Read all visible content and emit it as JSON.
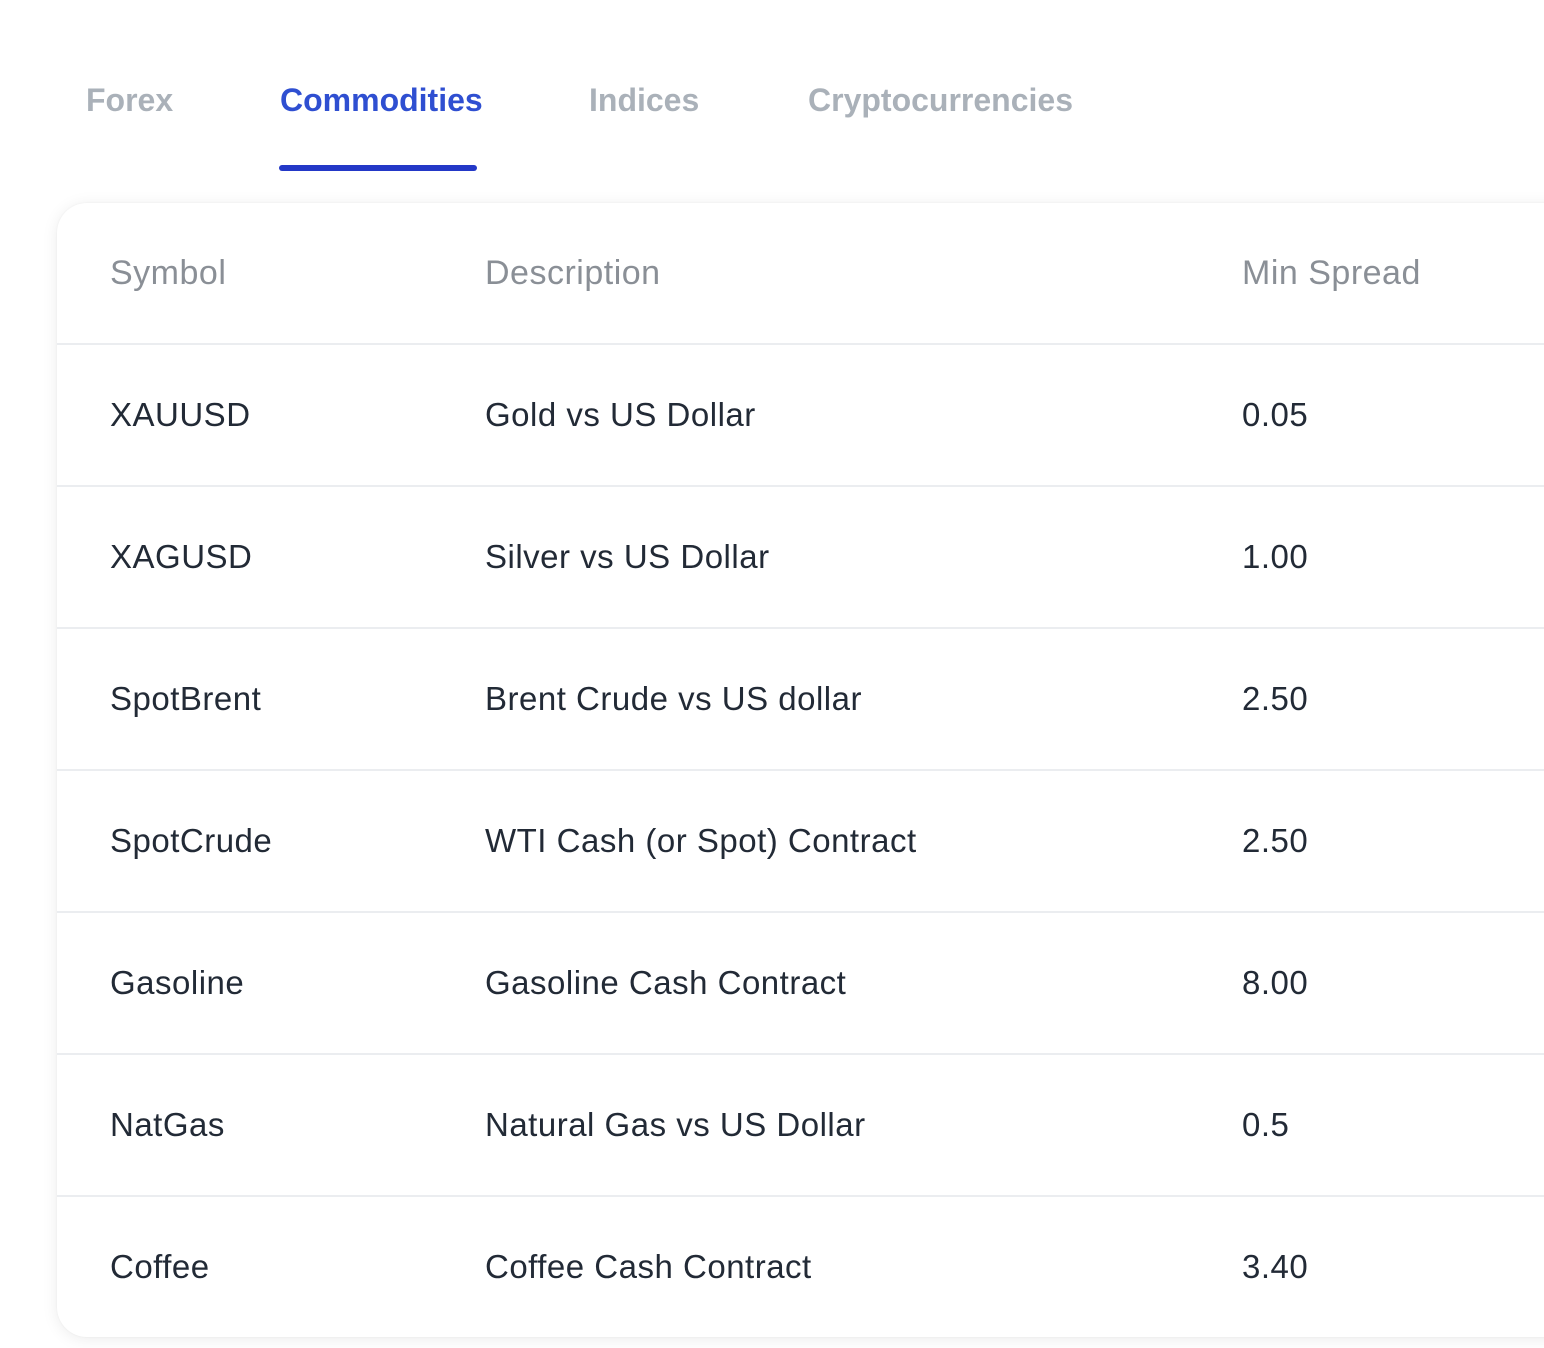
{
  "tabs": {
    "items": [
      {
        "label": "Forex"
      },
      {
        "label": "Commodities"
      },
      {
        "label": "Indices"
      },
      {
        "label": "Cryptocurrencies"
      }
    ],
    "active": "Commodities"
  },
  "colors": {
    "active_tab": "#2f4fd1",
    "inactive_tab": "#aab1b9",
    "underline": "#2338c7",
    "header_text": "#8a8f96",
    "body_text": "#222a36"
  },
  "table": {
    "columns": [
      "Symbol",
      "Description",
      "Min Spread"
    ],
    "rows": [
      [
        "XAUUSD",
        "Gold vs US Dollar",
        "0.05"
      ],
      [
        "XAGUSD",
        "Silver vs US Dollar",
        "1.00"
      ],
      [
        "SpotBrent",
        "Brent Crude vs US dollar",
        "2.50"
      ],
      [
        "SpotCrude",
        "WTI Cash (or Spot) Contract",
        "2.50"
      ],
      [
        "Gasoline",
        "Gasoline Cash Contract",
        "8.00"
      ],
      [
        "NatGas",
        "Natural Gas vs US Dollar",
        "0.5"
      ],
      [
        "Coffee",
        "Coffee Cash Contract",
        "3.40"
      ]
    ]
  }
}
